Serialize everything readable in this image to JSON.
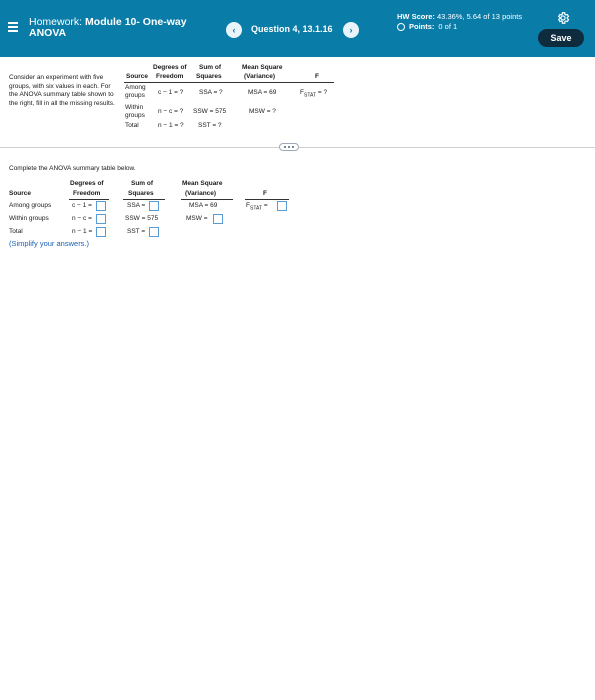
{
  "header": {
    "homework_prefix": "Homework:",
    "homework_name": "Module 10- One-way ANOVA",
    "question_label": "Question 4, 13.1.16",
    "nav_prev": "‹",
    "nav_next": "›",
    "hw_score_label": "HW Score:",
    "hw_score_value": "43.36%, 5.64 of 13 points",
    "points_label": "Points:",
    "points_value": "0 of 1",
    "save_label": "Save"
  },
  "problem": {
    "text": "Consider an experiment with five groups, with six values in each. For the ANOVA summary table shown to the right, fill in all the missing results."
  },
  "reference_table": {
    "headers": {
      "source": "Source",
      "df_line1": "Degrees of",
      "df_line2": "Freedom",
      "ss_line1": "Sum of",
      "ss_line2": "Squares",
      "ms_line1": "Mean Square",
      "ms_line2": "(Variance)",
      "f": "F"
    },
    "rows": [
      {
        "source": "Among groups",
        "df": "c − 1 = ?",
        "ss": "SSA = ?",
        "ms": "MSA = 69",
        "f": "F",
        "f_sub": "STAT",
        "f_tail": " = ?"
      },
      {
        "source": "Within groups",
        "df": "n − c = ?",
        "ss": "SSW = 575",
        "ms": "MSW = ?"
      },
      {
        "source": "Total",
        "df": "n − 1 = ?",
        "ss": "SST = ?"
      }
    ]
  },
  "instruction": "Complete the ANOVA summary table below.",
  "answer_table": {
    "headers": {
      "source": "Source",
      "df_line1": "Degrees of",
      "df_line2": "Freedom",
      "ss_line1": "Sum of",
      "ss_line2": "Squares",
      "ms_line1": "Mean Square",
      "ms_line2": "(Variance)",
      "f": "F"
    },
    "rows": [
      {
        "source": "Among groups",
        "df_prefix": "c − 1 =",
        "ss_prefix": "SSA =",
        "ms_text": "MSA = 69",
        "f_prefix": "F",
        "f_sub": "STAT",
        "f_eq": " ="
      },
      {
        "source": "Within groups",
        "df_prefix": "n − c =",
        "ss_text": "SSW = 575",
        "ms_prefix": "MSW ="
      },
      {
        "source": "Total",
        "df_prefix": "n − 1 =",
        "ss_prefix": "SST ="
      }
    ],
    "inputs": {
      "df_among": "",
      "df_within": "",
      "df_total": "",
      "ssa": "",
      "sst": "",
      "msw": "",
      "fstat": ""
    }
  },
  "simplify": "(Simplify your answers.)"
}
